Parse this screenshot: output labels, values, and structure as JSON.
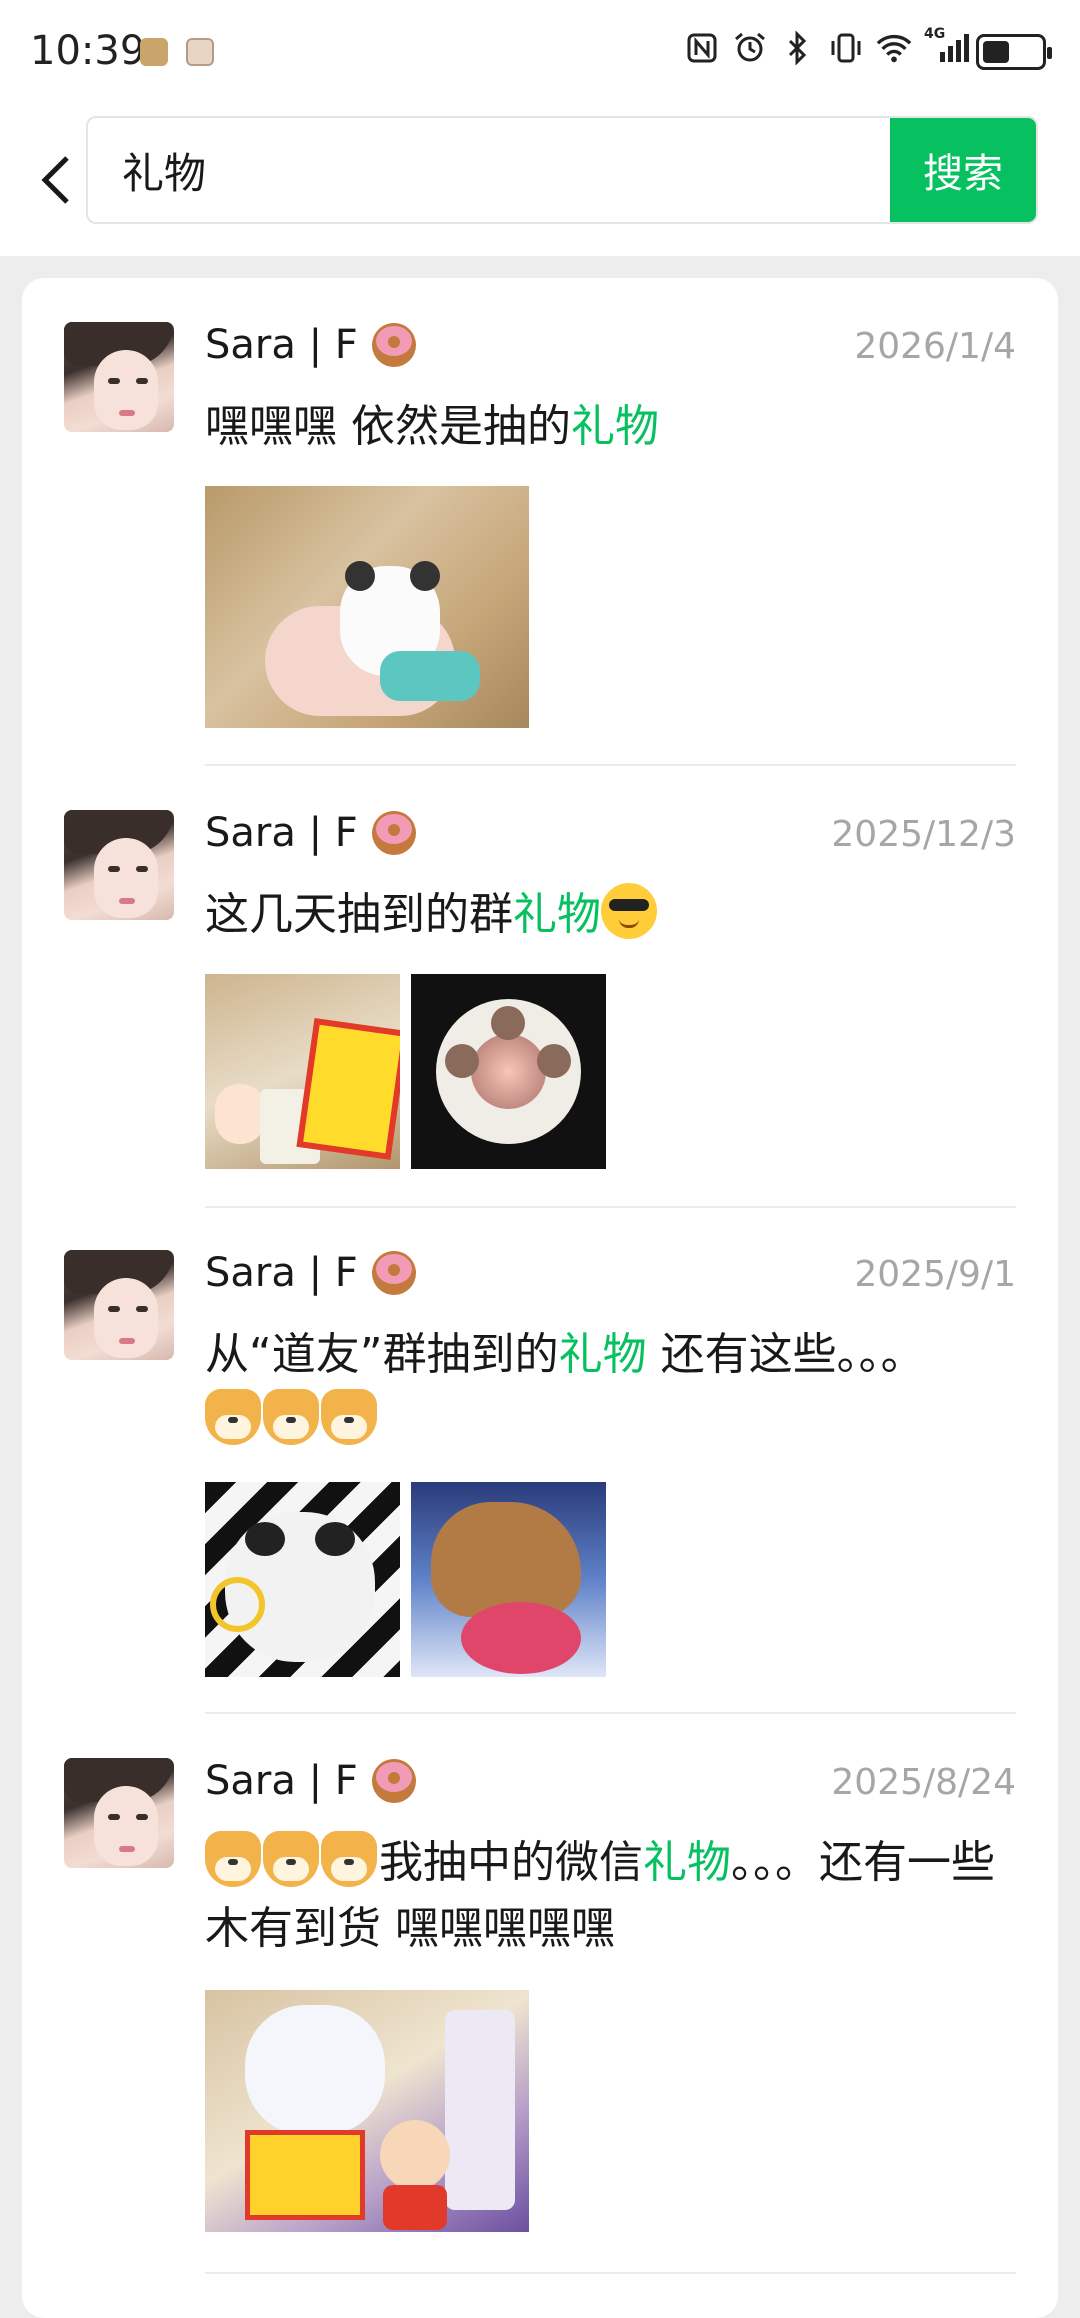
{
  "status_bar": {
    "time": "10:39",
    "network": "4G"
  },
  "search": {
    "query": "礼物",
    "button_label": "搜索"
  },
  "posts": [
    {
      "author": "Sara | F",
      "date": "2026/1/4",
      "text_parts": [
        "嘿嘿嘿 依然是抽的",
        "礼物",
        ""
      ]
    },
    {
      "author": "Sara | F",
      "date": "2025/12/3",
      "text_parts": [
        "这几天抽到的群",
        "礼物",
        ""
      ]
    },
    {
      "author": "Sara | F",
      "date": "2025/9/1",
      "text_parts": [
        "从“道友”群抽到的",
        "礼物",
        " 还有这些。。。"
      ]
    },
    {
      "author": "Sara | F",
      "date": "2025/8/24",
      "text_parts": [
        "我抽中的微信",
        "礼物",
        "。。。还有一些木有到货 嘿嘿嘿嘿嘿"
      ]
    }
  ],
  "colors": {
    "accent": "#07c160",
    "date_gray": "#a6a6a6",
    "page_bg": "#ededed"
  }
}
